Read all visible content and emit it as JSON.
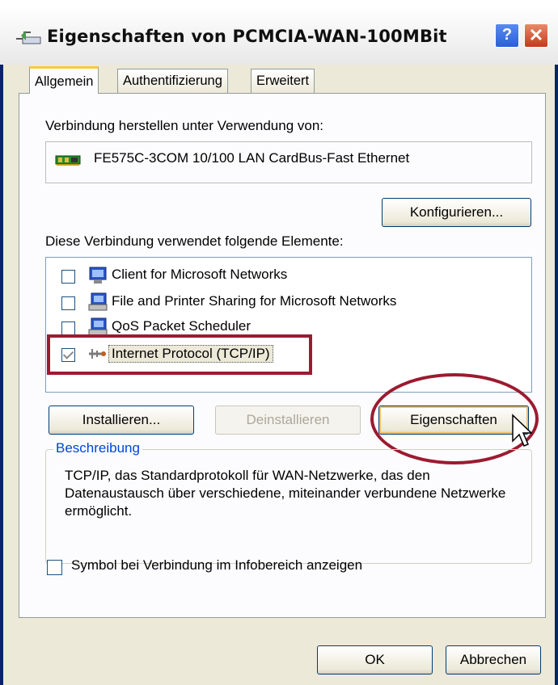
{
  "window": {
    "title": "Eigenschaften von PCMCIA-WAN-100MBit",
    "help_label": "?",
    "close_label": "✕"
  },
  "tabs": [
    {
      "label": "Allgemein",
      "selected": true
    },
    {
      "label": "Authentifizierung",
      "selected": false
    },
    {
      "label": "Erweitert",
      "selected": false
    }
  ],
  "general": {
    "connect_using_label": "Verbindung herstellen unter Verwendung von:",
    "device_name": "FE575C-3COM 10/100 LAN CardBus-Fast Ethernet",
    "configure_button": "Konfigurieren...",
    "components_label": "Diese Verbindung verwendet folgende Elemente:",
    "components": [
      {
        "label": "Client for Microsoft Networks",
        "checked": false,
        "icon": "network-client-icon"
      },
      {
        "label": "File and Printer Sharing for Microsoft Networks",
        "checked": false,
        "icon": "network-service-icon"
      },
      {
        "label": "QoS Packet Scheduler",
        "checked": false,
        "icon": "network-service-icon"
      },
      {
        "label": "Internet Protocol (TCP/IP)",
        "checked": true,
        "selected": true,
        "icon": "protocol-icon"
      }
    ],
    "install_button": "Installieren...",
    "uninstall_button": "Deinstallieren",
    "properties_button": "Eigenschaften",
    "description_legend": "Beschreibung",
    "description_text": "TCP/IP, das Standardprotokoll für WAN-Netzwerke, das den Datenaustausch über verschiedene, miteinander verbundene Netzwerke ermöglicht.",
    "notify_label": "Symbol bei Verbindung im Infobereich anzeigen",
    "notify_checked": false
  },
  "footer": {
    "ok_button": "OK",
    "cancel_button": "Abbrechen"
  },
  "colors": {
    "annotation": "#9b1b30",
    "dialog_bg": "#ece9d8",
    "legend": "#0046d5"
  }
}
